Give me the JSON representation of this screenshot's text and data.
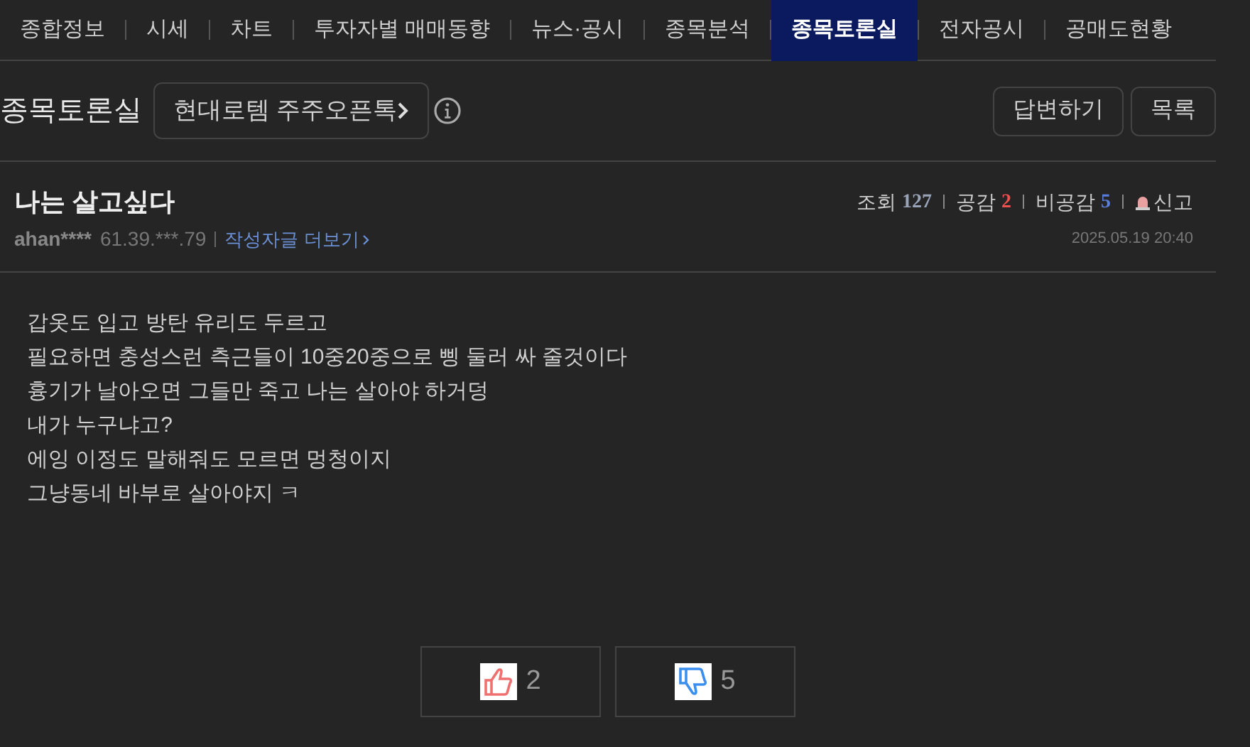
{
  "tabs": [
    {
      "label": "종합정보",
      "selected": false
    },
    {
      "label": "시세",
      "selected": false
    },
    {
      "label": "차트",
      "selected": false
    },
    {
      "label": "투자자별 매매동향",
      "selected": false
    },
    {
      "label": "뉴스·공시",
      "selected": false
    },
    {
      "label": "종목분석",
      "selected": false
    },
    {
      "label": "종목토론실",
      "selected": true
    },
    {
      "label": "전자공시",
      "selected": false
    },
    {
      "label": "공매도현황",
      "selected": false
    }
  ],
  "header": {
    "title": "종목토론실",
    "board_link": "현대로템 주주오픈톡",
    "buttons": [
      "답변하기",
      "목록"
    ]
  },
  "post": {
    "title": "나는 살고싶다",
    "author": "ahan****",
    "ip": "61.39.***.79",
    "more_link": "작성자글 더보기",
    "stats": [
      {
        "label": "조회",
        "value": "127",
        "kind": "views"
      },
      {
        "label": "공감",
        "value": "2",
        "kind": "likes"
      },
      {
        "label": "비공감",
        "value": "5",
        "kind": "dislikes"
      }
    ],
    "report": "신고",
    "date": "2025.05.19 20:40",
    "body": [
      "갑옷도 입고 방탄 유리도 두르고",
      "필요하면 충성스런 측근들이 10중20중으로 삥 둘러 싸 줄것이다",
      "흉기가 날아오면 그들만 죽고 나는 살아야 하거덩",
      "내가 누구냐고?",
      "에잉 이정도 말해줘도 모르면 멍청이지",
      "그냥동네 바부로 살아야지 ㅋ"
    ],
    "votes": [
      {
        "kind": "like",
        "count": "2"
      },
      {
        "kind": "dislike",
        "count": "5"
      }
    ]
  }
}
